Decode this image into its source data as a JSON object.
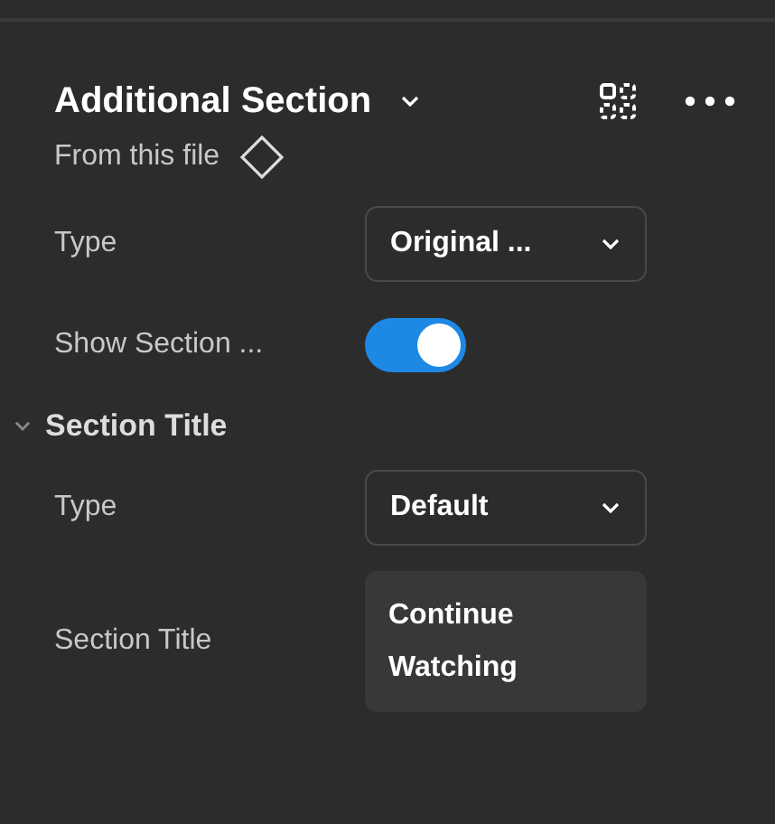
{
  "header": {
    "title": "Additional Section",
    "source": "From this file"
  },
  "properties": [
    {
      "kind": "select",
      "label": "Type",
      "value": "Original ..."
    },
    {
      "kind": "toggle",
      "label": "Show Section ...",
      "on": true
    }
  ],
  "group": {
    "title": "Section Title",
    "expanded": true,
    "properties": [
      {
        "kind": "select",
        "label": "Type",
        "value": "Default"
      },
      {
        "kind": "text",
        "label": "Section Title",
        "value": "Continue Watching"
      }
    ]
  }
}
